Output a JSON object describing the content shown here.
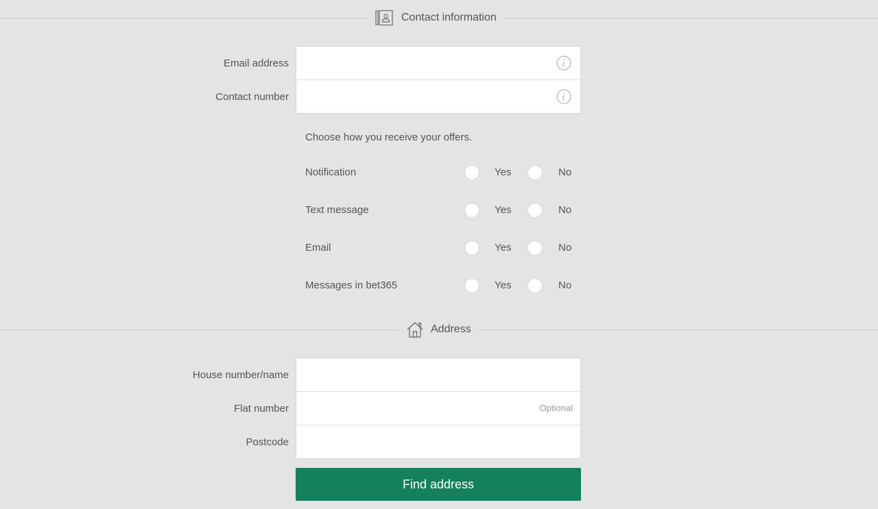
{
  "contact_section": {
    "title": "Contact information",
    "icon": "contact-book-icon",
    "fields": [
      {
        "label": "Email address",
        "value": "",
        "placeholder": "",
        "info_icon": "info-icon"
      },
      {
        "label": "Contact number",
        "value": "",
        "placeholder": "",
        "info_icon": "info-icon"
      }
    ]
  },
  "preferences": {
    "intro": "Choose how you receive your offers.",
    "yes_label": "Yes",
    "no_label": "No",
    "rows": [
      {
        "label": "Notification",
        "selected": null
      },
      {
        "label": "Text message",
        "selected": null
      },
      {
        "label": "Email",
        "selected": null
      },
      {
        "label": "Messages in bet365",
        "selected": null
      }
    ]
  },
  "address_section": {
    "title": "Address",
    "icon": "house-icon",
    "fields": [
      {
        "label": "House number/name",
        "value": "",
        "placeholder": ""
      },
      {
        "label": "Flat number",
        "value": "",
        "placeholder": "",
        "hint": "Optional"
      },
      {
        "label": "Postcode",
        "value": "",
        "placeholder": ""
      }
    ]
  },
  "find_address_button": {
    "label": "Find address"
  },
  "colors": {
    "background": "#e4e4e4",
    "text": "#545454",
    "button": "#14805e",
    "button_text": "#ffffff"
  }
}
